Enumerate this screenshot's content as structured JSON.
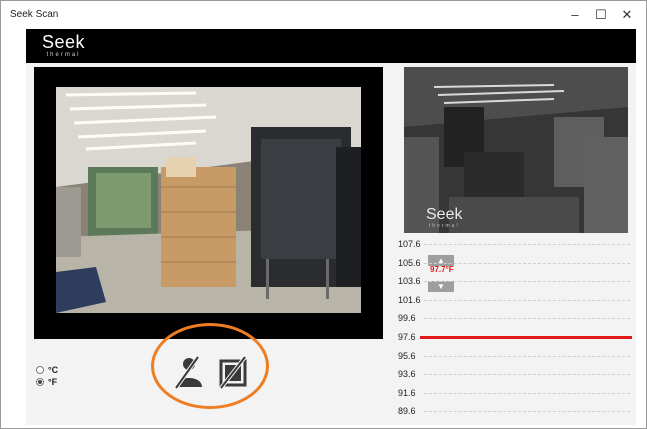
{
  "window": {
    "title": "Seek Scan",
    "minimize_glyph": "–",
    "maximize_glyph": "☐",
    "close_glyph": "✕"
  },
  "brand": {
    "logo_text": "Seek",
    "logo_subtext": "thermal"
  },
  "thermal_view": {
    "watermark_text": "Seek",
    "watermark_subtext": "thermal"
  },
  "scale": {
    "ticks": [
      "107.6",
      "105.6",
      "103.6",
      "101.6",
      "99.6",
      "97.6",
      "95.6",
      "93.6",
      "91.6",
      "89.6"
    ],
    "alarm_temperature": "97.7°F",
    "threshold_value": 97.6,
    "up_glyph": "▲",
    "down_glyph": "▼",
    "line_color": "#e01818"
  },
  "units": {
    "options": [
      {
        "label": "°C",
        "checked": false
      },
      {
        "label": "°F",
        "checked": true
      }
    ]
  },
  "toolbar": {
    "tools": [
      {
        "name": "person-detection-off-icon"
      },
      {
        "name": "frame-overlay-off-icon"
      }
    ]
  },
  "colors": {
    "highlight": "#ef7d22",
    "alarm": "#e01818"
  }
}
